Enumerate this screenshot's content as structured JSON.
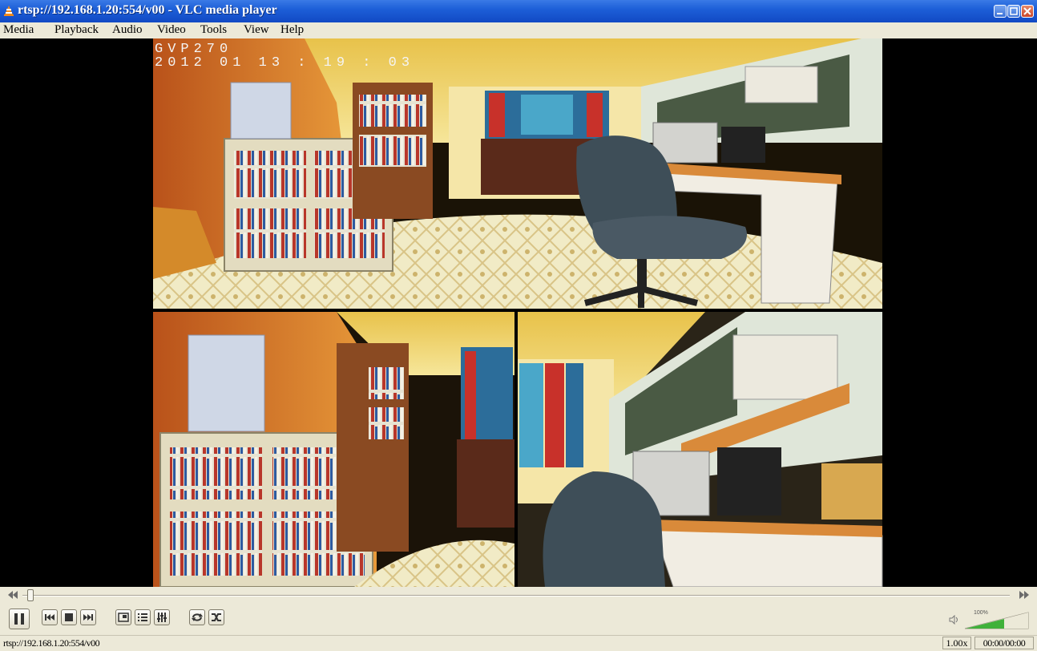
{
  "window": {
    "title": "rtsp://192.168.1.20:554/v00 - VLC media player",
    "app_icon": "vlc-cone-icon"
  },
  "menu": {
    "items": [
      "Media",
      "Playback",
      "Audio",
      "Video",
      "Tools",
      "View",
      "Help"
    ]
  },
  "video": {
    "osd_line1": "GVP270",
    "osd_line2": "2012  01    13 : 19 : 03"
  },
  "controls": {
    "seek_progress": 0.005,
    "volume": {
      "label": "100%",
      "level": 1.0
    }
  },
  "status": {
    "url": "rtsp://192.168.1.20:554/v00",
    "rate": "1.00x",
    "time": "00:00/00:00"
  },
  "colors": {
    "titlebar": "#1d5fd8",
    "chrome": "#ece9d8",
    "volume_green": "#3fb13a"
  }
}
